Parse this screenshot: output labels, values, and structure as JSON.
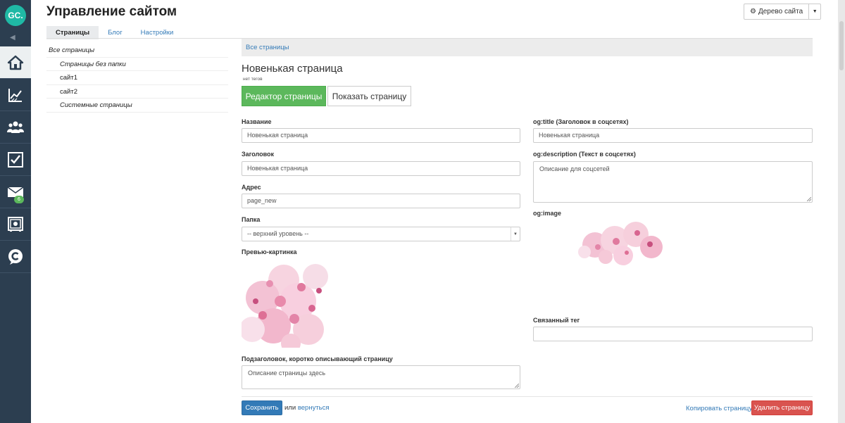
{
  "app": {
    "logo_text": "GC.",
    "title": "Управление сайтом"
  },
  "header": {
    "tree_button_label": "Дерево сайта"
  },
  "sidebar": {
    "mail_badge": "6"
  },
  "tabs": [
    {
      "label": "Страницы",
      "active": true
    },
    {
      "label": "Блог",
      "active": false
    },
    {
      "label": "Настройки",
      "active": false
    }
  ],
  "tree": {
    "items": [
      {
        "label": "Все страницы"
      },
      {
        "label": "Страницы без папки"
      },
      {
        "label": "сайт1"
      },
      {
        "label": "сайт2"
      },
      {
        "label": "Системные страницы"
      }
    ]
  },
  "breadcrumb": {
    "label": "Все страницы"
  },
  "page": {
    "title": "Новенькая страница",
    "tags_text": "нет тегов",
    "editor_button": "Редактор страницы",
    "show_button": "Показать страницу"
  },
  "form": {
    "name_label": "Название",
    "name_value": "Новенькая страница",
    "heading_label": "Заголовок",
    "heading_value": "Новенькая страница",
    "address_label": "Адрес",
    "address_value": "page_new",
    "folder_label": "Папка",
    "folder_value": "-- верхний уровень --",
    "preview_label": "Превью-картинка",
    "subtitle_label": "Подзаголовок, коротко описывающий страницу",
    "subtitle_placeholder": "Описание страницы здесь",
    "og_title_label": "og:title (Заголовок в соцсетях)",
    "og_title_value": "Новенькая страница",
    "og_desc_label": "og:description (Текст в соцсетях)",
    "og_desc_placeholder": "Описание для соцсетей",
    "og_image_label": "og:image",
    "linked_tag_label": "Связанный тег",
    "linked_tag_value": ""
  },
  "footer": {
    "save_button": "Сохранить",
    "or_text": "или",
    "back_link": "вернуться",
    "copy_link": "Копировать страницу",
    "delete_button": "Удалить страницу"
  },
  "colors": {
    "sidebar": "#2c3e50",
    "logo": "#1fb9a5",
    "primary": "#337ab7",
    "success": "#5cb85c",
    "danger": "#d9534f"
  }
}
